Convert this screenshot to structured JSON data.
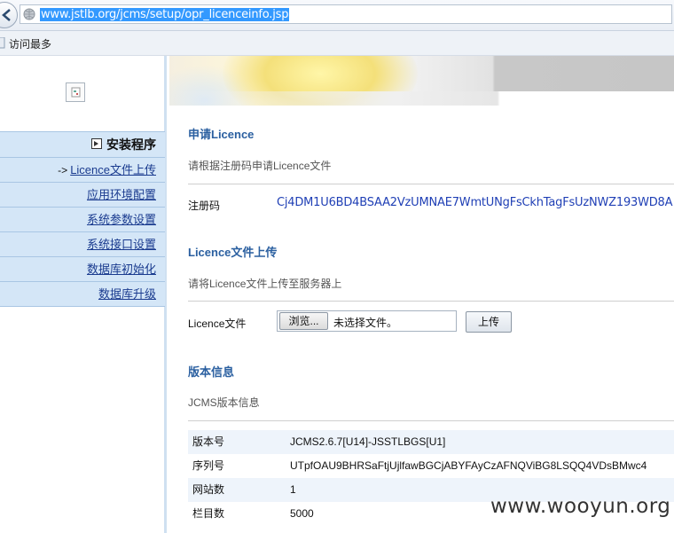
{
  "browser": {
    "url": "www.jstlb.org/jcms/setup/opr_licenceinfo.jsp",
    "favorites_label": "访问最多"
  },
  "sidebar": {
    "header": "安装程序",
    "current_arrow": "->",
    "items": [
      {
        "label": "Licence文件上传"
      },
      {
        "label": "应用环境配置"
      },
      {
        "label": "系统参数设置"
      },
      {
        "label": "系统接口设置"
      },
      {
        "label": "数据库初始化"
      },
      {
        "label": "数据库升级"
      }
    ]
  },
  "apply": {
    "title": "申请Licence",
    "subtitle": "请根据注册码申请Licence文件",
    "reg_label": "注册码",
    "reg_code": "Cj4DM1U6BD4BSAA2VzUMNAE7WmtUNgFsCkhTagFsUzNWZ193WD8A"
  },
  "upload": {
    "title": "Licence文件上传",
    "subtitle": "请将Licence文件上传至服务器上",
    "file_label": "Licence文件",
    "browse_label": "浏览...",
    "file_status": "未选择文件。",
    "upload_label": "上传"
  },
  "version": {
    "title": "版本信息",
    "subtitle": "JCMS版本信息",
    "rows": [
      {
        "key": "版本号",
        "value": "JCMS2.6.7[U14]-JSSTLBGS[U1]"
      },
      {
        "key": "序列号",
        "value": "UTpfOAU9BHRSaFtjUjlfawBGCjABYFAyCzAFNQViBG8LSQQ4VDsBMwc4"
      },
      {
        "key": "网站数",
        "value": "1"
      },
      {
        "key": "栏目数",
        "value": "5000"
      }
    ]
  },
  "watermark": "www.wooyun.org"
}
